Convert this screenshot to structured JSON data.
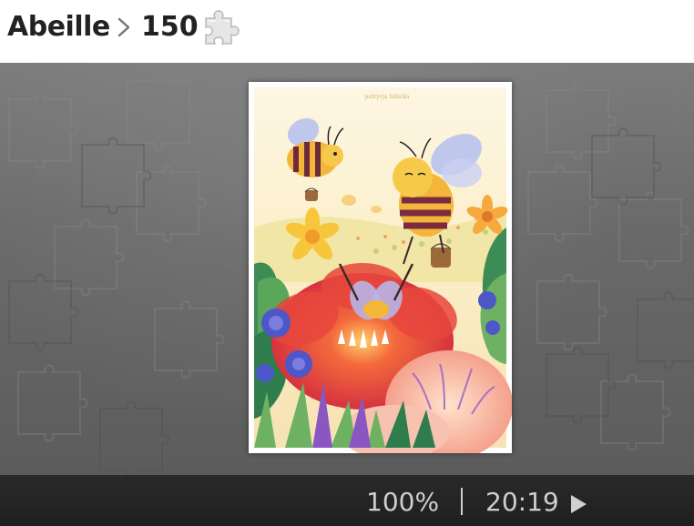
{
  "breadcrumb": {
    "title": "Abeille",
    "piece_count": "150"
  },
  "icons": {
    "separator": "chevron-right-icon",
    "pieces": "puzzle-piece-icon",
    "play": "play-icon"
  },
  "artwork": {
    "signature": "patrycja fabicka"
  },
  "status": {
    "zoom": "100%",
    "timer": "20:19"
  },
  "colors": {
    "board": "#6e6e6e",
    "footer": "#232323",
    "status_text": "#cfcfcf",
    "header_text": "#222222"
  }
}
